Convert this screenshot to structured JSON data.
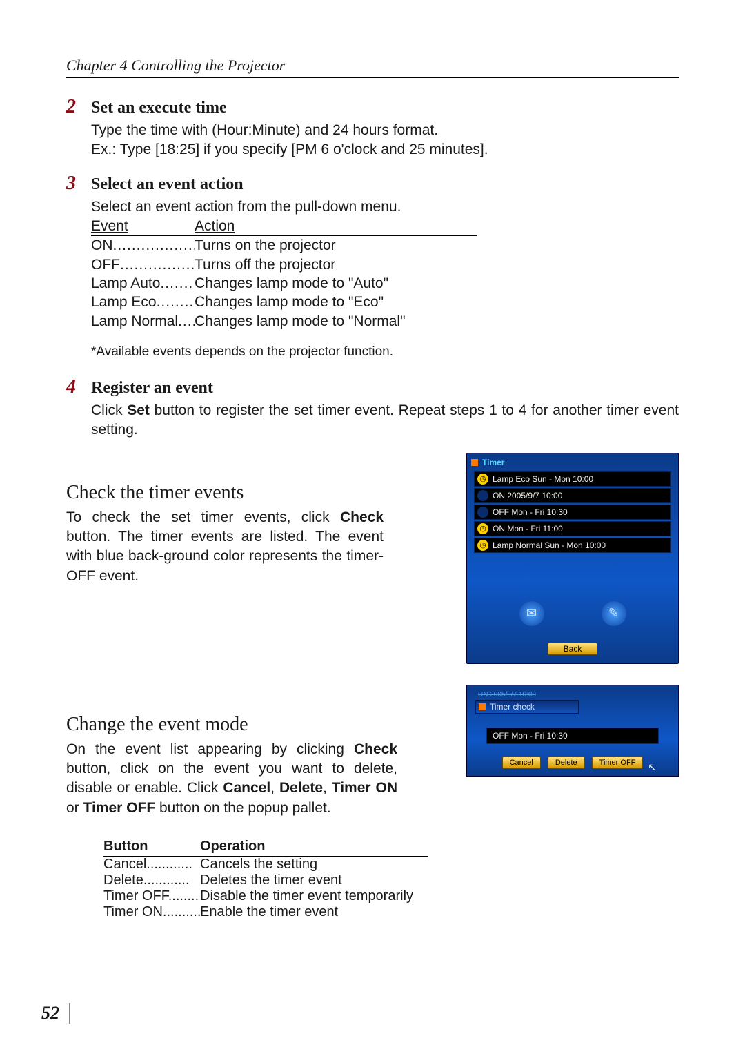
{
  "chapter_header": "Chapter 4 Controlling the Projector",
  "page_number": "52",
  "step2": {
    "num": "2",
    "title": "Set an execute time",
    "line1": "Type the time with (Hour:Minute) and 24 hours format.",
    "line2a": "Ex.: Type [18:25] if you specify [PM 6 o'clock and 25 minutes]."
  },
  "step3": {
    "num": "3",
    "title": "Select an event action",
    "intro": "Select an event action from the pull-down menu.",
    "col1": "Event",
    "col2": "Action",
    "rows": [
      {
        "e": "ON",
        "a": "Turns on the projector"
      },
      {
        "e": "OFF",
        "a": "Turns off the projector"
      },
      {
        "e": "Lamp Auto",
        "a": "Changes lamp mode to \"Auto\""
      },
      {
        "e": "Lamp Eco",
        "a": "Changes lamp mode to \"Eco\""
      },
      {
        "e": "Lamp Normal",
        "a": "Changes lamp mode to \"Normal\""
      }
    ],
    "note": "*Available events depends on the projector function."
  },
  "step4": {
    "num": "4",
    "title": "Register an event",
    "body_pre": "Click ",
    "body_bold": "Set",
    "body_post": " button to register the set timer event. Repeat steps 1 to 4 for another timer event setting."
  },
  "check": {
    "title": "Check the timer events",
    "body_pre": "To check the set timer events, click ",
    "body_bold": "Check",
    "body_post": " button. The timer events are listed. The event with blue back-ground color represents the timer-OFF event."
  },
  "timer_panel": {
    "title": "Timer",
    "rows": [
      {
        "enabled": true,
        "text": "Lamp Eco Sun - Mon 10:00"
      },
      {
        "enabled": false,
        "text": "ON 2005/9/7 10:00"
      },
      {
        "enabled": false,
        "text": "OFF Mon - Fri 10:30"
      },
      {
        "enabled": true,
        "text": "ON Mon - Fri 11:00"
      },
      {
        "enabled": true,
        "text": "Lamp Normal Sun - Mon 10:00"
      }
    ],
    "icon_mail": "✉",
    "icon_tool": "✎",
    "back": "Back"
  },
  "change": {
    "title": "Change the event mode",
    "body_p1": "On the event list appearing by clicking ",
    "body_b1": "Check",
    "body_p2": " button, click on the event you want to delete, disable or enable. Click ",
    "body_b2": "Cancel",
    "body_p3": ", ",
    "body_b3": "Delete",
    "body_p4": ", ",
    "body_b4": "Timer ON",
    "body_p5": " or ",
    "body_b5": "Timer OFF",
    "body_p6": " button on the popup pallet."
  },
  "popup": {
    "title": "Timer check",
    "selected": "OFF Mon - Fri 10:30",
    "buttons": {
      "cancel": "Cancel",
      "delete": "Delete",
      "timer_off": "Timer OFF"
    }
  },
  "btn_table": {
    "col1": "Button",
    "col2": "Operation",
    "rows": [
      {
        "b": "Cancel",
        "o": "Cancels the setting"
      },
      {
        "b": "Delete",
        "o": "Deletes the timer event"
      },
      {
        "b": "Timer OFF",
        "o": "Disable the timer event temporarily"
      },
      {
        "b": "Timer ON",
        "o": "Enable the timer event"
      }
    ]
  }
}
